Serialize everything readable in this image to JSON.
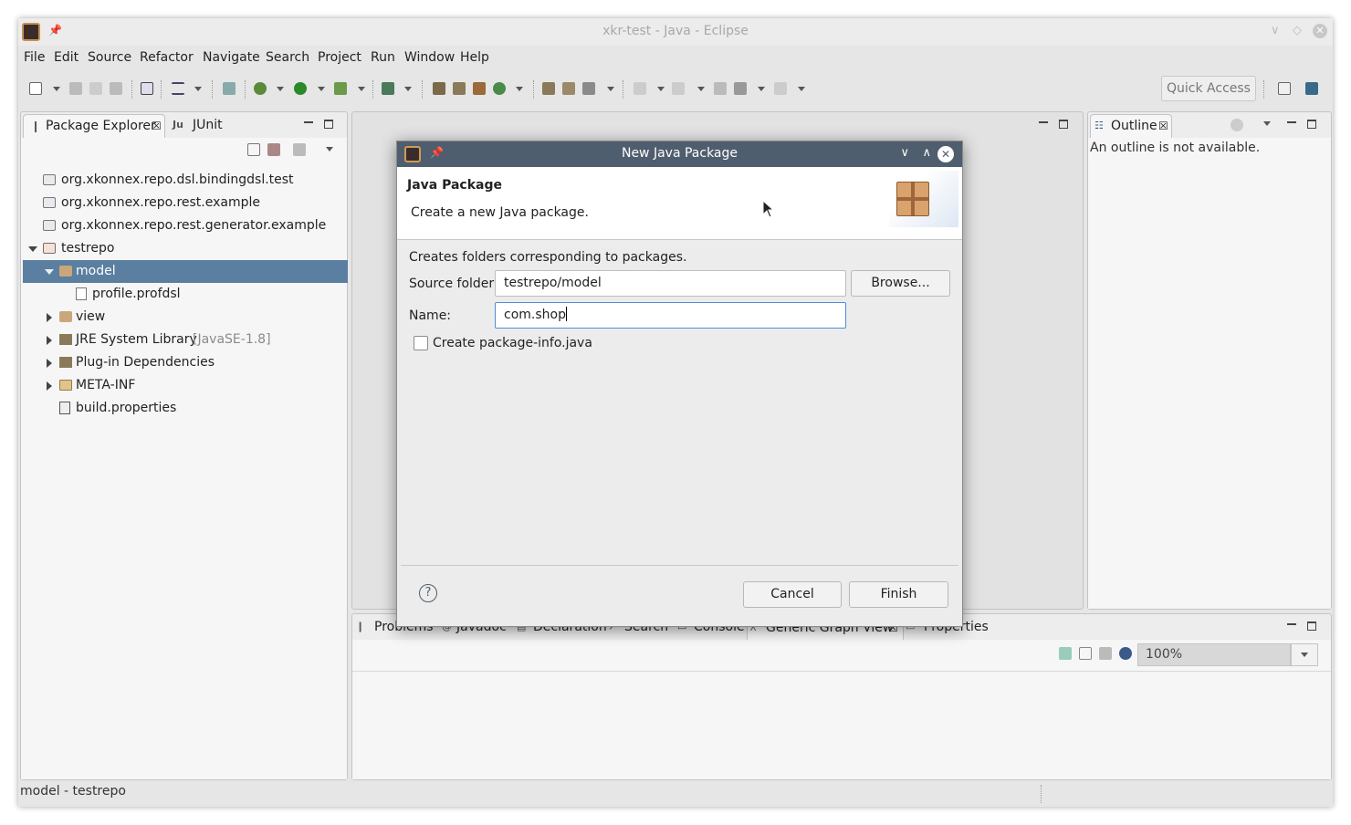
{
  "window": {
    "title": "xkr-test - Java - Eclipse"
  },
  "menu": [
    "File",
    "Edit",
    "Source",
    "Refactor",
    "Navigate",
    "Search",
    "Project",
    "Run",
    "Window",
    "Help"
  ],
  "toolbar": {
    "quick_access": "Quick Access"
  },
  "package_explorer": {
    "tabs": [
      "Package Explorer",
      "JUnit"
    ],
    "tree": [
      {
        "label": "org.xkonnex.repo.dsl.bindingdsl.test",
        "icon": "project-icon"
      },
      {
        "label": "org.xkonnex.repo.rest.example",
        "icon": "project-icon"
      },
      {
        "label": "org.xkonnex.repo.rest.generator.example",
        "icon": "project-icon"
      },
      {
        "label": "testrepo",
        "icon": "plugin-project-icon"
      },
      {
        "label": "model",
        "icon": "source-folder-icon"
      },
      {
        "label": "profile.profdsl",
        "icon": "file-icon"
      },
      {
        "label": "view",
        "icon": "source-folder-icon"
      },
      {
        "label": "JRE System Library",
        "suffix": "[JavaSE-1.8]",
        "icon": "library-icon"
      },
      {
        "label": "Plug-in Dependencies",
        "icon": "library-icon"
      },
      {
        "label": "META-INF",
        "icon": "folder-icon"
      },
      {
        "label": "build.properties",
        "icon": "properties-file-icon"
      }
    ]
  },
  "outline": {
    "tab": "Outline",
    "message": "An outline is not available."
  },
  "bottom_panel": {
    "tabs": [
      "Problems",
      "Javadoc",
      "Declaration",
      "Search",
      "Console",
      "Generic Graph View",
      "Properties"
    ],
    "zoom": "100%"
  },
  "status": {
    "text": "model - testrepo"
  },
  "dialog": {
    "title": "New Java Package",
    "heading": "Java Package",
    "subheading": "Create a new Java package.",
    "description": "Creates folders corresponding to packages.",
    "source_folder_label": "Source folder:",
    "source_folder_value": "testrepo/model",
    "browse_label": "Browse...",
    "name_label": "Name:",
    "name_value": "com.shop",
    "checkbox_label": "Create package-info.java",
    "checkbox_checked": false,
    "cancel_label": "Cancel",
    "finish_label": "Finish",
    "help_symbol": "?"
  },
  "colors": {
    "selection": "#5a7fa0",
    "dialog_title_bg": "#4f5e6e",
    "focus_border": "#4a90d9"
  }
}
